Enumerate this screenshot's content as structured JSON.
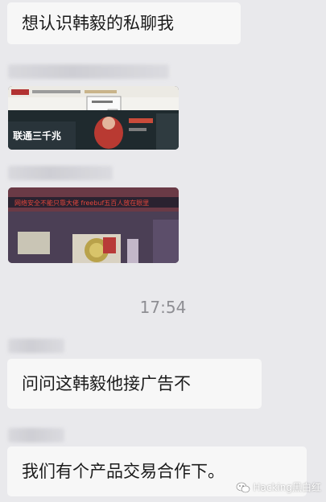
{
  "messages": {
    "m1": "想认识韩毅的私聊我",
    "m2": "问问这韩毅他接广告不",
    "m3": "我们有个产品交易合作下。"
  },
  "timestamp": "17:54",
  "image1": {
    "banner_text": "联通三千兆"
  },
  "image2": {
    "banner_text": "网络安全不能只靠大佬 freebuf五百人放在眼里"
  },
  "watermark": {
    "text": "Hacking黑白红"
  }
}
